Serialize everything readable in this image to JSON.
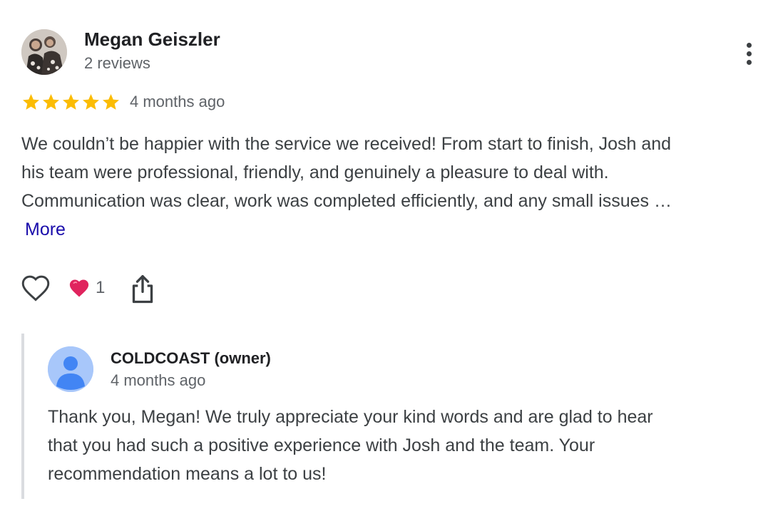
{
  "review": {
    "reviewer_name": "Megan Geiszler",
    "reviewer_meta": "2 reviews",
    "rating": 5,
    "max_rating": 5,
    "time": "4 months ago",
    "text_lines": [
      "We couldn’t be happier with the service we received! From start to finish, Josh and",
      "his team were professional, friendly, and genuinely a pleasure to deal with.",
      "Communication was clear, work was completed efficiently, and any small issues …"
    ],
    "more_label": "More",
    "reaction_count": "1"
  },
  "owner_reply": {
    "name": "COLDCOAST (owner)",
    "time": "4 months ago",
    "text_lines": [
      "Thank you, Megan! We truly appreciate your kind words and are glad to hear",
      "that you had such a positive experience with Josh and the team. Your",
      "recommendation means a lot to us!"
    ]
  },
  "icons": {
    "menu": "more-vert-icon",
    "star": "star-icon",
    "like": "heart-outline-icon",
    "reaction": "red-heart-icon",
    "share": "share-icon",
    "owner_avatar": "person-icon"
  },
  "colors": {
    "star": "#fbbc04",
    "link": "#1a0dab",
    "heart": "#e0245e",
    "owner_avatar_bg": "#a8c7fa",
    "owner_avatar_fg": "#4285f4",
    "reply_border": "#dadce0"
  }
}
